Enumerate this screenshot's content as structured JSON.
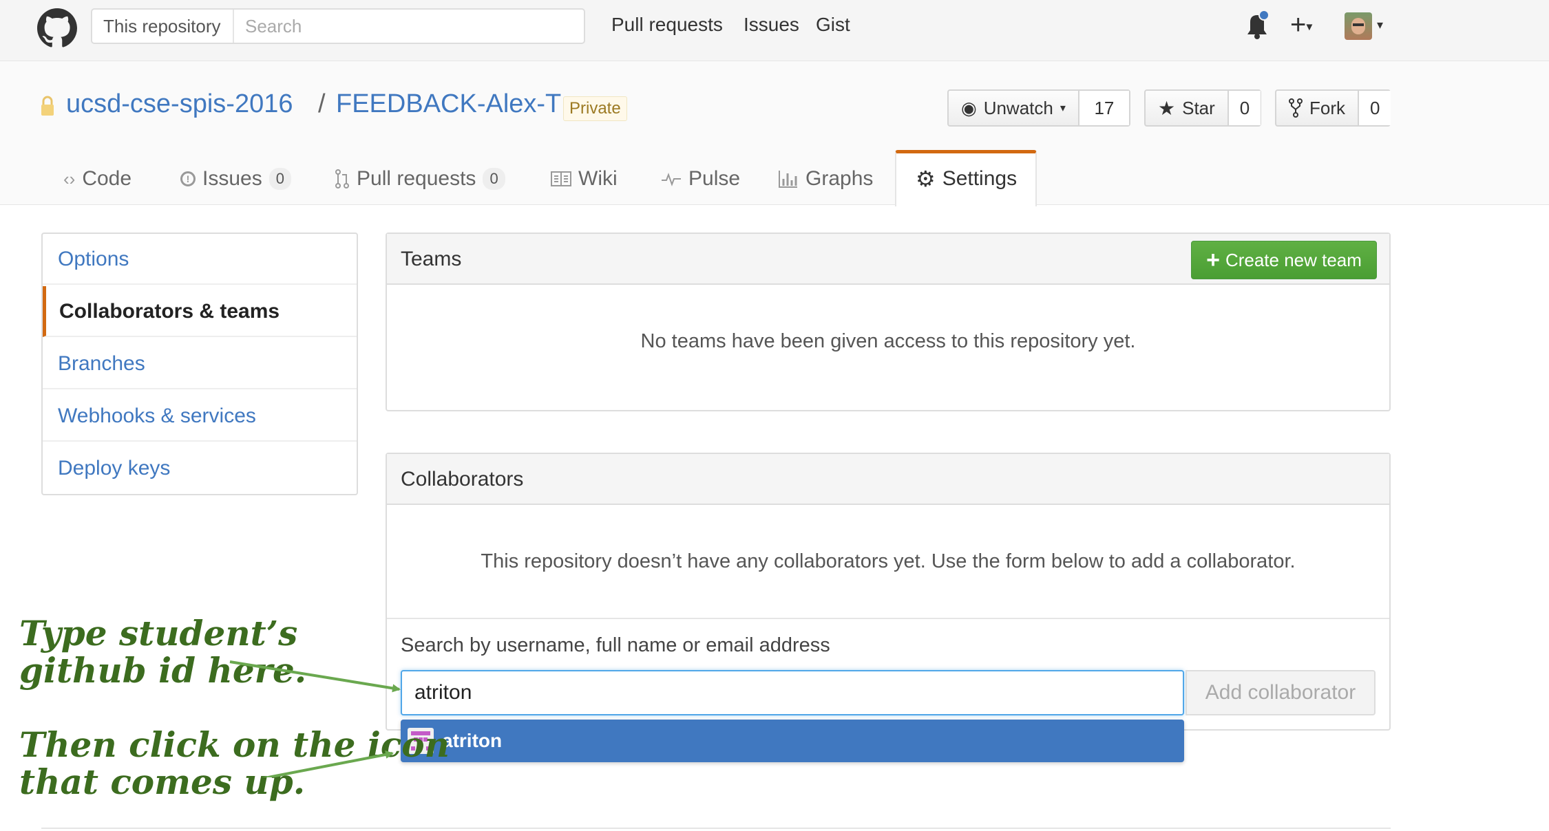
{
  "header": {
    "search_scope": "This repository",
    "search_placeholder": "Search",
    "nav": [
      "Pull requests",
      "Issues",
      "Gist"
    ]
  },
  "repo": {
    "owner": "ucsd-cse-spis-2016",
    "separator": "/",
    "name": "FEEDBACK-Alex-T",
    "visibility": "Private",
    "watch_label": "Unwatch",
    "watch_count": "17",
    "star_label": "Star",
    "star_count": "0",
    "fork_label": "Fork",
    "fork_count": "0"
  },
  "tabs": [
    {
      "label": "Code"
    },
    {
      "label": "Issues",
      "count": "0"
    },
    {
      "label": "Pull requests",
      "count": "0"
    },
    {
      "label": "Wiki"
    },
    {
      "label": "Pulse"
    },
    {
      "label": "Graphs"
    },
    {
      "label": "Settings",
      "selected": true
    }
  ],
  "sidebar": {
    "items": [
      {
        "label": "Options"
      },
      {
        "label": "Collaborators & teams",
        "selected": true
      },
      {
        "label": "Branches"
      },
      {
        "label": "Webhooks & services"
      },
      {
        "label": "Deploy keys"
      }
    ]
  },
  "teams": {
    "title": "Teams",
    "create_label": "Create new team",
    "empty_message": "No teams have been given access to this repository yet."
  },
  "collaborators": {
    "title": "Collaborators",
    "empty_message": "This repository doesn’t have any collaborators yet. Use the form below to add a collaborator.",
    "search_label": "Search by username, full name or email address",
    "input_value": "atriton",
    "add_label": "Add collaborator",
    "suggestion": "atriton"
  },
  "annotations": {
    "first": "Type student’s\ngithub id here.",
    "second": "Then click on the icon\nthat comes up."
  },
  "colors": {
    "link": "#4078c0",
    "accent_tab": "#d26911",
    "create_button": "#60b044",
    "annotation": "#3c6c1f",
    "suggestion_bg": "#4078c0"
  }
}
